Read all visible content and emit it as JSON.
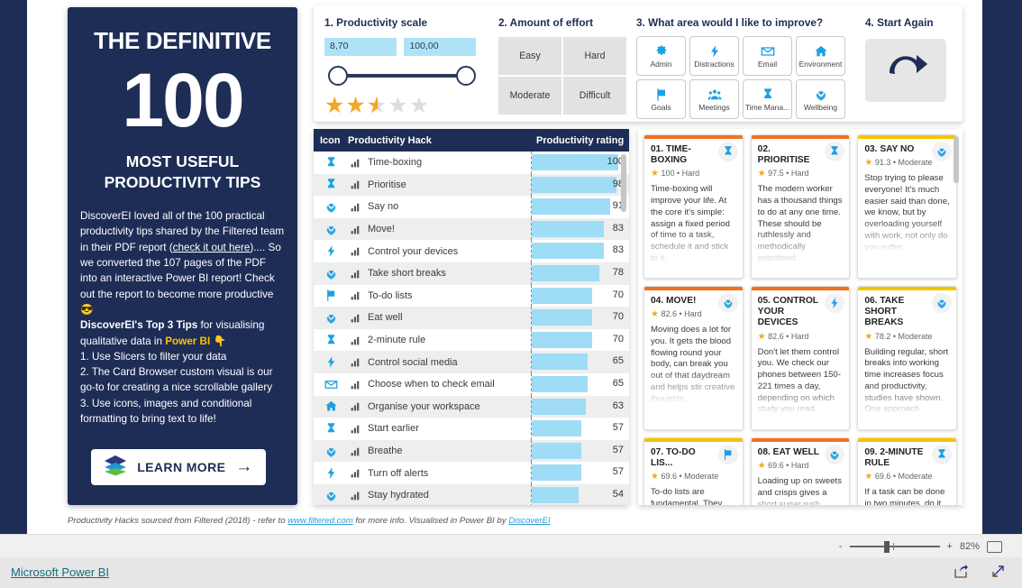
{
  "left_panel": {
    "title": "THE DEFINITIVE",
    "big_number": "100",
    "subtitle_line1": "MOST USEFUL",
    "subtitle_line2": "PRODUCTIVITY TIPS",
    "intro_pre": "DiscoverEI loved all of the 100 practical productivity tips shared by the Filtered team in their PDF report (",
    "intro_link": "check it out here",
    "intro_post": ").... So we converted the 107 pages of the PDF into an interactive Power BI report! Check out the report to become more productive 😎",
    "tips_heading": "DiscoverEI's Top 3 Tips",
    "tips_heading_rest": " for visualising qualitative data in ",
    "tips_brand": "Power BI",
    "tips_arrow": "👇",
    "tip_1": "1. Use Slicers to filter your data",
    "tip_2": "2. The Card Browser custom visual is our go-to for creating a nice scrollable gallery",
    "tip_3": "3. Use icons, images and conditional formatting to bring text to life!",
    "learn_more_label": "LEARN MORE",
    "learn_more_arrow": "→"
  },
  "slicer_productivity": {
    "heading": "1. Productivity scale",
    "min_value": "8,70",
    "max_value": "100,00",
    "stars_filled": 2.5,
    "stars_total": 5
  },
  "slicer_effort": {
    "heading": "2. Amount of effort",
    "options": [
      "Easy",
      "Hard",
      "Moderate",
      "Difficult"
    ]
  },
  "slicer_area": {
    "heading": "3. What area would I like to improve?",
    "options": [
      {
        "label": "Admin",
        "icon": "gear-icon"
      },
      {
        "label": "Distractions",
        "icon": "lightning-icon"
      },
      {
        "label": "Email",
        "icon": "envelope-icon"
      },
      {
        "label": "Environment",
        "icon": "house-icon"
      },
      {
        "label": "Goals",
        "icon": "flag-icon"
      },
      {
        "label": "Meetings",
        "icon": "people-icon"
      },
      {
        "label": "Time Mana...",
        "icon": "hourglass-icon"
      },
      {
        "label": "Wellbeing",
        "icon": "hands-heart-icon"
      }
    ]
  },
  "slicer_reset": {
    "heading": "4. Start Again",
    "icon": "refresh-cycle-icon"
  },
  "table": {
    "columns": [
      "Icon",
      "Productivity Hack",
      "Productivity rating"
    ],
    "max_rating": 100,
    "rows": [
      {
        "icon": "hourglass-icon",
        "hack": "Time-boxing",
        "rating": 100
      },
      {
        "icon": "hourglass-icon",
        "hack": "Prioritise",
        "rating": 98
      },
      {
        "icon": "hands-heart-icon",
        "hack": "Say no",
        "rating": 91
      },
      {
        "icon": "hands-heart-icon",
        "hack": "Move!",
        "rating": 83
      },
      {
        "icon": "lightning-icon",
        "hack": "Control your devices",
        "rating": 83
      },
      {
        "icon": "hands-heart-icon",
        "hack": "Take short breaks",
        "rating": 78
      },
      {
        "icon": "flag-icon",
        "hack": "To-do lists",
        "rating": 70
      },
      {
        "icon": "hands-heart-icon",
        "hack": "Eat well",
        "rating": 70
      },
      {
        "icon": "hourglass-icon",
        "hack": "2-minute rule",
        "rating": 70
      },
      {
        "icon": "lightning-icon",
        "hack": "Control social media",
        "rating": 65
      },
      {
        "icon": "envelope-icon",
        "hack": "Choose when to check email",
        "rating": 65
      },
      {
        "icon": "house-icon",
        "hack": "Organise your workspace",
        "rating": 63
      },
      {
        "icon": "hourglass-icon",
        "hack": "Start earlier",
        "rating": 57
      },
      {
        "icon": "hands-heart-icon",
        "hack": "Breathe",
        "rating": 57
      },
      {
        "icon": "lightning-icon",
        "hack": "Turn off alerts",
        "rating": 57
      },
      {
        "icon": "hands-heart-icon",
        "hack": "Stay hydrated",
        "rating": 54
      }
    ]
  },
  "gallery": {
    "cards": [
      {
        "title": "01. TIME-BOXING",
        "rating": "100",
        "effort": "Hard",
        "body": "Time-boxing will improve your life. At the core it's simple: assign a fixed period of time to a task, schedule it and stick to it.",
        "icon": "hourglass-icon",
        "bar_color": "#f4701f"
      },
      {
        "title": "02. PRIORITISE",
        "rating": "97.5",
        "effort": "Hard",
        "body": "The modern worker has a thousand things to do at any one time. These should be ruthlessly and methodically prioritised.",
        "icon": "hourglass-icon",
        "bar_color": "#f4701f"
      },
      {
        "title": "03. SAY NO",
        "rating": "91.3",
        "effort": "Moderate",
        "body": "Stop trying to please everyone! It's much easier said than done, we know, but by overloading yourself with work, not only do you suffer.",
        "icon": "hands-heart-icon",
        "bar_color": "#f5c400"
      },
      {
        "title": "04. MOVE!",
        "rating": "82.6",
        "effort": "Hard",
        "body": "Moving does a lot for you. It gets the blood flowing round your body, can break you out of that daydream and helps stir creative thoughts.",
        "icon": "hands-heart-icon",
        "bar_color": "#f4701f"
      },
      {
        "title": "05. CONTROL YOUR DEVICES",
        "rating": "82.6",
        "effort": "Hard",
        "body": "Don't let them control you. We check our phones between 150-221 times a day, depending on which study you read.",
        "icon": "lightning-icon",
        "bar_color": "#f4701f"
      },
      {
        "title": "06. TAKE SHORT BREAKS",
        "rating": "78.2",
        "effort": "Moderate",
        "body": "Building regular, short breaks into working time increases focus and productivity, studies have shown. One approach.",
        "icon": "hands-heart-icon",
        "bar_color": "#f5c400"
      },
      {
        "title": "07. TO-DO LIS...",
        "rating": "69.6",
        "effort": "Moderate",
        "body": "To-do lists are fundamental. They free up mental space.",
        "icon": "flag-icon",
        "bar_color": "#f5c400"
      },
      {
        "title": "08. EAT WELL",
        "rating": "69.6",
        "effort": "Hard",
        "body": "Loading up on sweets and crisps gives a short sugar rush.",
        "icon": "hands-heart-icon",
        "bar_color": "#f4701f"
      },
      {
        "title": "09. 2-MINUTE RULE",
        "rating": "69.6",
        "effort": "Moderate",
        "body": "If a task can be done in two minutes, do it now.",
        "icon": "hourglass-icon",
        "bar_color": "#f5c400"
      }
    ]
  },
  "footer": {
    "text_1": "Productivity Hacks sourced from Filtered (2018) - refer to ",
    "link_1": "www.filtered.com",
    "text_2": " for more info. Visualised in Power BI by ",
    "link_2": "DiscoverEI"
  },
  "statusbar": {
    "zoom_out": "-",
    "zoom_in": "+",
    "zoom_level": "82%",
    "fit_icon": "fit-to-page-icon"
  },
  "bottombar": {
    "brand_link": "Microsoft Power BI",
    "share_icon": "share-icon",
    "fullscreen_icon": "fullscreen-icon"
  }
}
